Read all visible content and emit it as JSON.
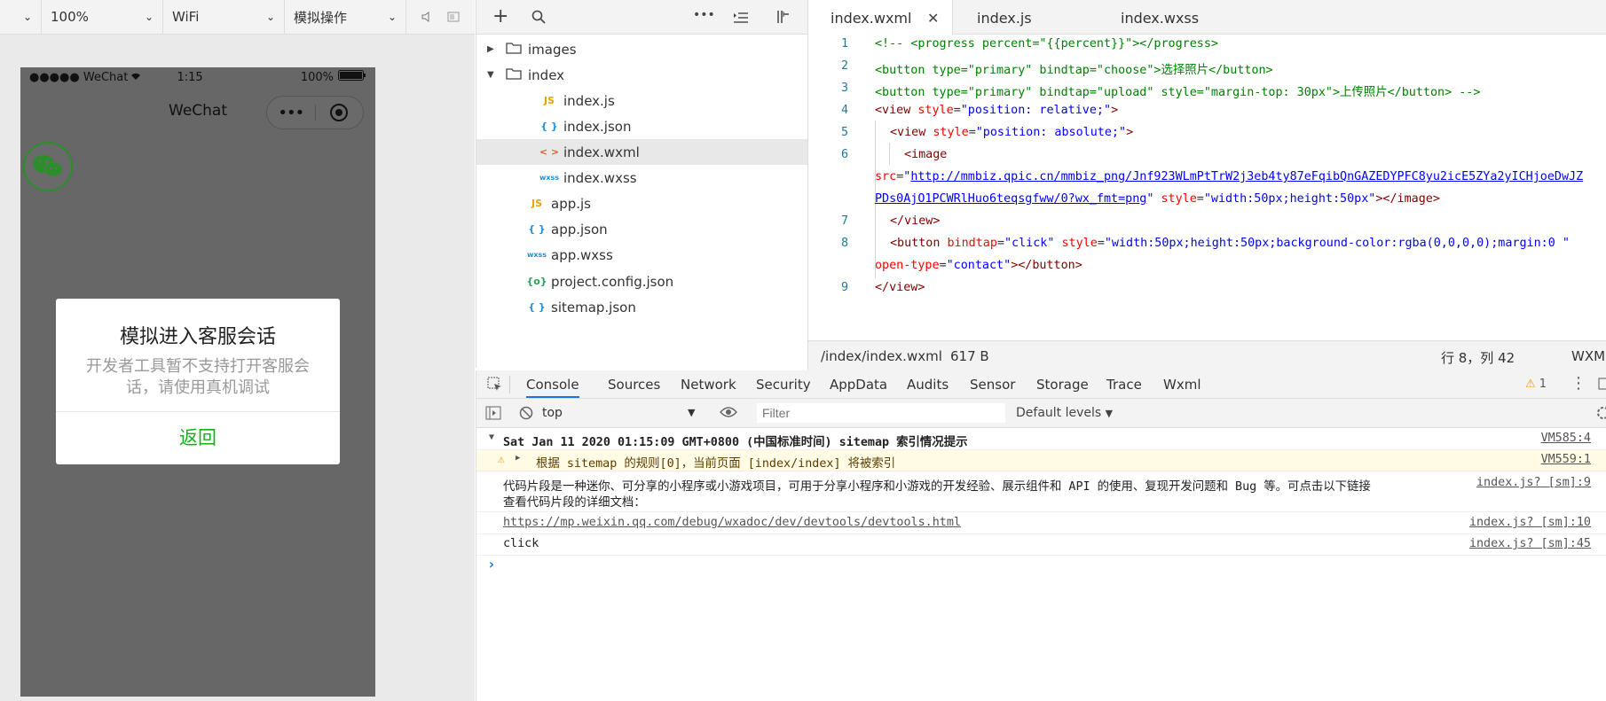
{
  "simulator_toolbar": {
    "zoom": "100%",
    "network": "WiFi",
    "operation": "模拟操作"
  },
  "phone": {
    "signal": "●●●●● WeChat",
    "time": "1:15",
    "battery": "100%",
    "nav_title": "WeChat",
    "dialog": {
      "title": "模拟进入客服会话",
      "message": "开发者工具暂不支持打开客服会话，请使用真机调试",
      "button": "返回"
    }
  },
  "file_tree": {
    "items": [
      {
        "label": "images",
        "icon": "folder",
        "icon_text": "",
        "arrow": "▶"
      },
      {
        "label": "index",
        "icon": "folder-open",
        "icon_text": "",
        "arrow": "▼"
      },
      {
        "label": "index.js",
        "icon": "js",
        "icon_text": "JS"
      },
      {
        "label": "index.json",
        "icon": "json",
        "icon_text": "{ }"
      },
      {
        "label": "index.wxml",
        "icon": "wxml",
        "icon_text": "< >"
      },
      {
        "label": "index.wxss",
        "icon": "wxss",
        "icon_text": "wxss"
      },
      {
        "label": "app.js",
        "icon": "js",
        "icon_text": "JS"
      },
      {
        "label": "app.json",
        "icon": "json",
        "icon_text": "{ }"
      },
      {
        "label": "app.wxss",
        "icon": "wxss",
        "icon_text": "wxss"
      },
      {
        "label": "project.config.json",
        "icon": "config",
        "icon_text": "{o}"
      },
      {
        "label": "sitemap.json",
        "icon": "json",
        "icon_text": "{ }"
      }
    ]
  },
  "editor": {
    "tabs": [
      "index.wxml",
      "index.js",
      "index.wxss"
    ],
    "line_numbers": [
      "1",
      "2",
      "3",
      "4",
      "5",
      "6",
      "7",
      "8",
      "9"
    ],
    "status": {
      "path": "/index/index.wxml",
      "size": "617 B",
      "position": "行 8，列 42",
      "language": "WXML"
    }
  },
  "devtools": {
    "tabs": [
      "Console",
      "Sources",
      "Network",
      "Security",
      "AppData",
      "Audits",
      "Sensor",
      "Storage",
      "Trace",
      "Wxml"
    ],
    "warning_count": "1",
    "context": "top",
    "filter_placeholder": "Filter",
    "levels": "Default levels",
    "messages": {
      "header": "Sat Jan 11 2020 01:15:09 GMT+0800 (中国标准时间) sitemap 索引情况提示",
      "header_src": "VM585:4",
      "warning": "根据 sitemap 的规则[0]，当前页面 [index/index] 将被索引",
      "warning_src": "VM559:1",
      "info_line1": "代码片段是一种迷你、可分享的小程序或小游戏项目，可用于分享小程序和小游戏的开发经验、展示组件和 API 的使用、复现开发问题和 Bug 等。可点击以下链接",
      "info_line2": "查看代码片段的详细文档：",
      "info_src": "index.js? [sm]:9",
      "link": "https://mp.weixin.qq.com/debug/wxadoc/dev/devtools/devtools.html",
      "link_src": "index.js? [sm]:10",
      "log": "click",
      "log_src": "index.js? [sm]:45",
      "prompt": "›"
    }
  }
}
